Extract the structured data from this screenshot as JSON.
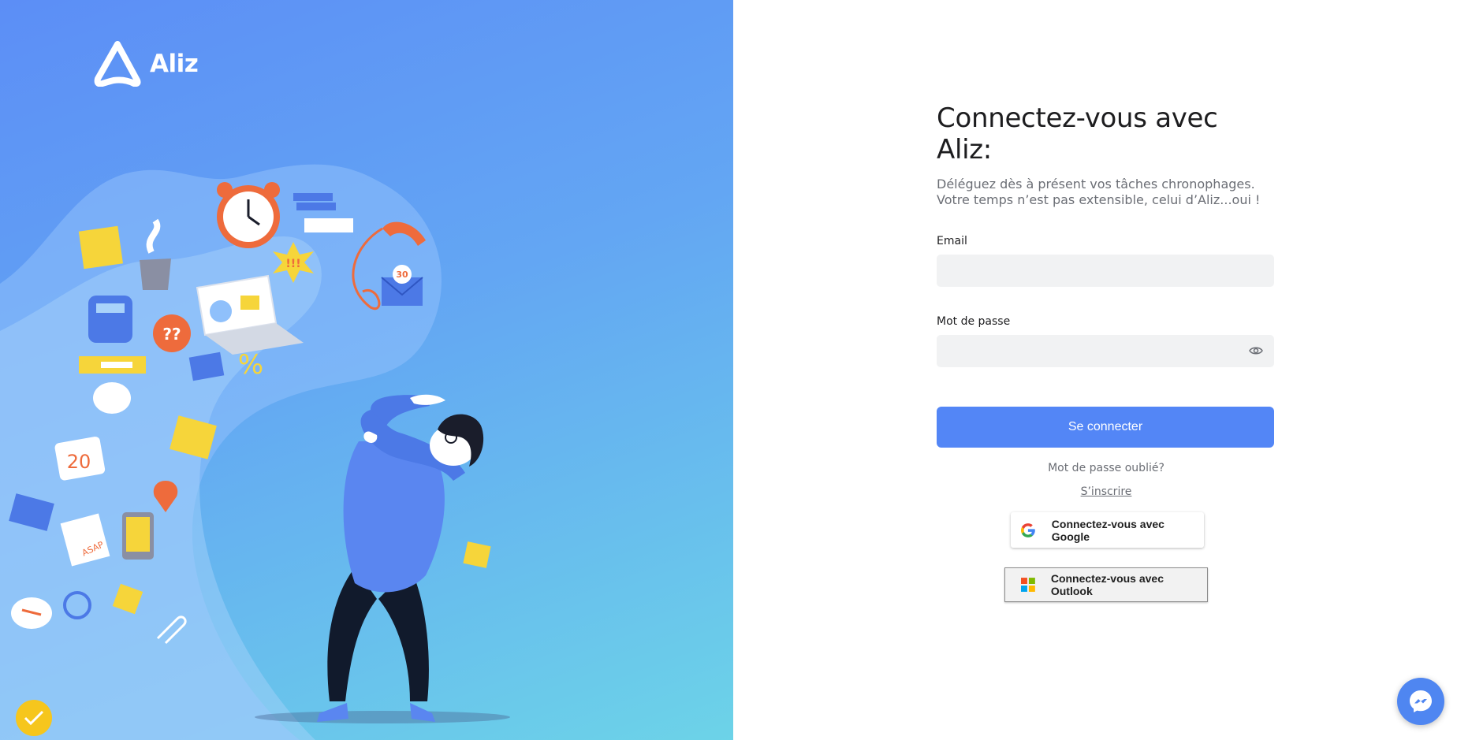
{
  "brand": {
    "name": "Aliz",
    "logo_icon": "aliz-logo-icon"
  },
  "login": {
    "title": "Connectez-vous avec Aliz:",
    "subtitle": "Déléguez dès à présent vos tâches chronophages. Votre temps n’est pas extensible, celui d’Aliz...oui !",
    "email_label": "Email",
    "email_value": "",
    "password_label": "Mot de passe",
    "password_value": "",
    "password_toggle_icon": "eye-icon",
    "submit_label": "Se connecter",
    "forgot_label": "Mot de passe oublié?",
    "signup_label": "S’inscrire"
  },
  "sso": {
    "google_label": "Connectez-vous avec Google",
    "outlook_label": "Connectez-vous avec Outlook"
  },
  "widgets": {
    "messenger_icon": "messenger-icon",
    "checklist_icon": "checkmark-badge-icon"
  },
  "colors": {
    "primary": "#5386f6",
    "hero_top": "#5c8ef6",
    "hero_bottom": "#6cd3e8",
    "field_bg": "#f1f2f3",
    "text_dark": "#1d1d1f",
    "text_muted": "#6b6e75",
    "badge_yellow": "#f6c61d"
  },
  "illustration": {
    "subject": "stressed-man-with-flying-tasks",
    "calendar_number": "20",
    "note_text": "ASAP",
    "envelope_badge": "30",
    "alert_text": "!!!",
    "question_text": "??"
  }
}
